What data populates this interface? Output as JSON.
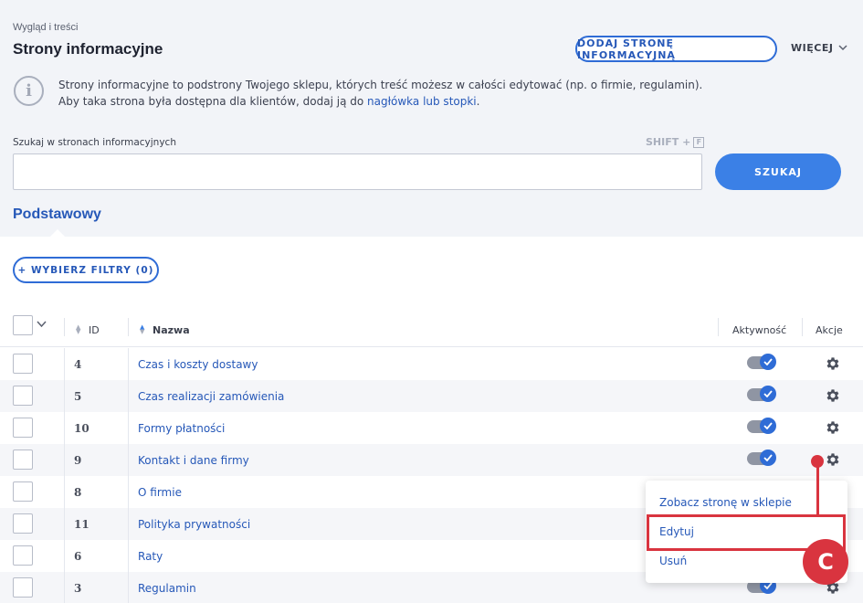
{
  "header": {
    "breadcrumb": "Wygląd i treści",
    "title": "Strony informacyjne",
    "add_button": "DODAJ STRONĘ INFORMACYJNĄ",
    "more_label": "WIĘCEJ"
  },
  "info": {
    "line1": "Strony informacyjne to podstrony Twojego sklepu, których treść możesz w całości edytować (np. o firmie, regulamin).",
    "line2_prefix": "Aby taka strona była dostępna dla klientów, dodaj ją do ",
    "line2_link": "nagłówka lub stopki",
    "line2_suffix": "."
  },
  "search": {
    "label": "Szukaj w stronach informacyjnych",
    "shortcut": "SHIFT +",
    "shortcut_key": "F",
    "value": "",
    "button": "SZUKAJ"
  },
  "tabs": [
    {
      "label": "Podstawowy",
      "active": true
    }
  ],
  "filters": {
    "button": "+ WYBIERZ FILTRY (0)"
  },
  "table": {
    "columns": {
      "id": "ID",
      "name": "Nazwa",
      "active": "Aktywność",
      "actions": "Akcje"
    },
    "rows": [
      {
        "id": "4",
        "name": "Czas i koszty dostawy",
        "active": true
      },
      {
        "id": "5",
        "name": "Czas realizacji zamówienia",
        "active": true
      },
      {
        "id": "10",
        "name": "Formy płatności",
        "active": true
      },
      {
        "id": "9",
        "name": "Kontakt i dane firmy",
        "active": true
      },
      {
        "id": "8",
        "name": "O firmie",
        "active": true
      },
      {
        "id": "11",
        "name": "Polityka prywatności",
        "active": true
      },
      {
        "id": "6",
        "name": "Raty",
        "active": true
      },
      {
        "id": "3",
        "name": "Regulamin",
        "active": true
      }
    ]
  },
  "dropdown": {
    "items": [
      "Zobacz stronę w sklepie",
      "Edytuj",
      "Usuń"
    ]
  },
  "annotation": {
    "badge": "C"
  },
  "colors": {
    "accent": "#2f6cd6",
    "marker": "#d9343f"
  }
}
